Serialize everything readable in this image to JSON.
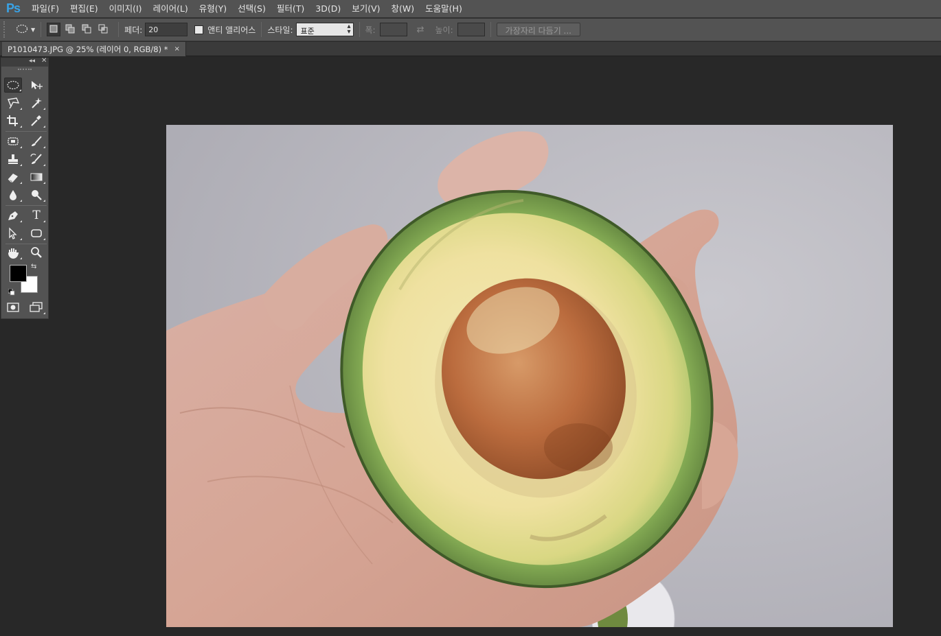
{
  "app": {
    "logo": "Ps",
    "accent": "#39a3e6"
  },
  "menu": [
    {
      "label": "파일(F)"
    },
    {
      "label": "편집(E)"
    },
    {
      "label": "이미지(I)"
    },
    {
      "label": "레이어(L)"
    },
    {
      "label": "유형(Y)"
    },
    {
      "label": "선택(S)"
    },
    {
      "label": "필터(T)"
    },
    {
      "label": "3D(D)"
    },
    {
      "label": "보기(V)"
    },
    {
      "label": "창(W)"
    },
    {
      "label": "도움말(H)"
    }
  ],
  "options": {
    "tool_icon": "elliptical-marquee-icon",
    "feather_label": "페더:",
    "feather_value": "20",
    "antialias_label": "앤티 앨리어스",
    "antialias_checked": false,
    "style_label": "스타일:",
    "style_value": "표준",
    "width_label": "폭:",
    "width_value": "",
    "height_label": "높이:",
    "height_value": "",
    "refine_edge_label": "가장자리 다듬기 ..."
  },
  "document": {
    "tab_title": "P1010473.JPG @ 25% (레이어 0, RGB/8) *",
    "close_glyph": "×"
  },
  "toolbox": {
    "collapse_glyph": "◂◂",
    "close_glyph": "✕",
    "foreground_color": "#000000",
    "background_color": "#ffffff",
    "tools": [
      {
        "name": "elliptical-marquee-tool",
        "active": true
      },
      {
        "name": "move-tool"
      },
      {
        "name": "polygonal-lasso-tool"
      },
      {
        "name": "magic-wand-tool"
      },
      {
        "name": "crop-tool"
      },
      {
        "name": "eyedropper-tool"
      },
      {
        "name": "spot-healing-tool"
      },
      {
        "name": "brush-tool"
      },
      {
        "name": "clone-stamp-tool"
      },
      {
        "name": "history-brush-tool"
      },
      {
        "name": "eraser-tool"
      },
      {
        "name": "gradient-tool"
      },
      {
        "name": "blur-tool"
      },
      {
        "name": "dodge-tool"
      },
      {
        "name": "pen-tool"
      },
      {
        "name": "type-tool"
      },
      {
        "name": "path-selection-tool"
      },
      {
        "name": "rectangle-tool"
      },
      {
        "name": "hand-tool"
      },
      {
        "name": "zoom-tool"
      }
    ],
    "type_tool_glyph": "T"
  },
  "image": {
    "subject": "hand-holding-avocado-half-photo",
    "backdrop_color": "#c3c2c9",
    "skin_color": "#d8a998",
    "avocado_skin_color": "#5a7a3c",
    "avocado_flesh_color": "#efe3a2",
    "seed_color": "#b8663a"
  }
}
